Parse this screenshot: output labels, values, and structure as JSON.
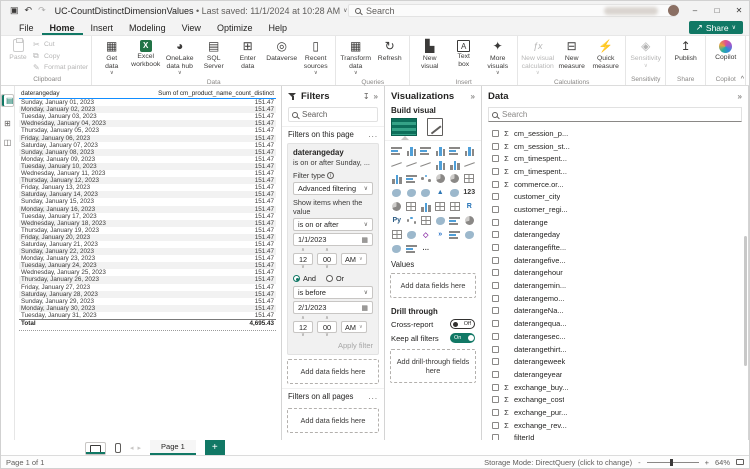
{
  "colors": {
    "accent_teal": "#117865",
    "header_underline_blue": "#118dff",
    "excel_green": "#217346",
    "toggle_on": "#117865"
  },
  "titlebar": {
    "title": "UC-CountDistinctDimensionValues",
    "saved": "• Last saved: 11/1/2024 at 10:28 AM",
    "search_placeholder": "Search"
  },
  "menu": {
    "items": [
      "File",
      "Home",
      "Insert",
      "Modeling",
      "View",
      "Optimize",
      "Help"
    ],
    "active": "Home",
    "share_label": "Share"
  },
  "ribbon": {
    "collapse_icon": "^",
    "groups": [
      {
        "name": "Clipboard",
        "layout": "clipboard",
        "paste": "Paste",
        "small": [
          {
            "label": "Cut",
            "glyph": "✂"
          },
          {
            "label": "Copy",
            "glyph": "⧉"
          },
          {
            "label": "Format painter",
            "glyph": "✎"
          }
        ]
      },
      {
        "name": "Data",
        "buttons": [
          {
            "label": "Get\ndata",
            "glyph": "▦",
            "caret": true
          },
          {
            "label": "Excel\nworkbook",
            "kind": "excel"
          },
          {
            "label": "OneLake\ndata hub",
            "glyph": "◕",
            "caret": true
          },
          {
            "label": "SQL\nServer",
            "glyph": "▤"
          },
          {
            "label": "Enter\ndata",
            "glyph": "⊞"
          },
          {
            "label": "Dataverse",
            "glyph": "◎"
          },
          {
            "label": "Recent\nsources",
            "glyph": "▯",
            "caret": true
          }
        ]
      },
      {
        "name": "Queries",
        "buttons": [
          {
            "label": "Transform\ndata",
            "glyph": "▦",
            "caret": true
          },
          {
            "label": "Refresh",
            "glyph": "↻"
          }
        ]
      },
      {
        "name": "Insert",
        "buttons": [
          {
            "label": "New\nvisual",
            "glyph": "▙"
          },
          {
            "label": "Text\nbox",
            "kind": "textbox"
          },
          {
            "label": "More\nvisuals",
            "glyph": "✦",
            "caret": true
          }
        ]
      },
      {
        "name": "Calculations",
        "buttons": [
          {
            "label": "New visual\ncalculation",
            "kind": "fx",
            "caret": true,
            "disabled": true
          },
          {
            "label": "New\nmeasure",
            "glyph": "⊟"
          },
          {
            "label": "Quick\nmeasure",
            "glyph": "⚡"
          }
        ]
      },
      {
        "name": "Sensitivity",
        "buttons": [
          {
            "label": "Sensitivity",
            "glyph": "◈",
            "caret": true,
            "disabled": true
          }
        ]
      },
      {
        "name": "Share",
        "buttons": [
          {
            "label": "Publish",
            "glyph": "↥"
          }
        ]
      },
      {
        "name": "Copilot",
        "buttons": [
          {
            "label": "Copilot",
            "kind": "copilot"
          }
        ]
      }
    ]
  },
  "rail": {
    "items": [
      {
        "name": "report-view",
        "glyph": "▤",
        "selected": true
      },
      {
        "name": "table-view",
        "glyph": "⊞",
        "selected": false
      },
      {
        "name": "model-view",
        "glyph": "◫",
        "selected": false
      }
    ]
  },
  "canvas": {
    "table": {
      "col1": "daterangeday",
      "col2": "Sum of cm_product_name_count_distinct",
      "rows": [
        [
          "Sunday, January 01, 2023",
          "151.47"
        ],
        [
          "Monday, January 02, 2023",
          "151.47"
        ],
        [
          "Tuesday, January 03, 2023",
          "151.47"
        ],
        [
          "Wednesday, January 04, 2023",
          "151.47"
        ],
        [
          "Thursday, January 05, 2023",
          "151.47"
        ],
        [
          "Friday, January 06, 2023",
          "151.47"
        ],
        [
          "Saturday, January 07, 2023",
          "151.47"
        ],
        [
          "Sunday, January 08, 2023",
          "151.47"
        ],
        [
          "Monday, January 09, 2023",
          "151.47"
        ],
        [
          "Tuesday, January 10, 2023",
          "151.47"
        ],
        [
          "Wednesday, January 11, 2023",
          "151.47"
        ],
        [
          "Thursday, January 12, 2023",
          "151.47"
        ],
        [
          "Friday, January 13, 2023",
          "151.47"
        ],
        [
          "Saturday, January 14, 2023",
          "151.47"
        ],
        [
          "Sunday, January 15, 2023",
          "151.47"
        ],
        [
          "Monday, January 16, 2023",
          "151.47"
        ],
        [
          "Tuesday, January 17, 2023",
          "151.47"
        ],
        [
          "Wednesday, January 18, 2023",
          "151.47"
        ],
        [
          "Thursday, January 19, 2023",
          "151.47"
        ],
        [
          "Friday, January 20, 2023",
          "151.47"
        ],
        [
          "Saturday, January 21, 2023",
          "151.47"
        ],
        [
          "Sunday, January 22, 2023",
          "151.47"
        ],
        [
          "Monday, January 23, 2023",
          "151.47"
        ],
        [
          "Tuesday, January 24, 2023",
          "151.47"
        ],
        [
          "Wednesday, January 25, 2023",
          "151.47"
        ],
        [
          "Thursday, January 26, 2023",
          "151.47"
        ],
        [
          "Friday, January 27, 2023",
          "151.47"
        ],
        [
          "Saturday, January 28, 2023",
          "151.47"
        ],
        [
          "Sunday, January 29, 2023",
          "151.47"
        ],
        [
          "Monday, January 30, 2023",
          "151.47"
        ],
        [
          "Tuesday, January 31, 2023",
          "151.47"
        ]
      ],
      "total_label": "Total",
      "total_value": "4,695.43"
    }
  },
  "filters": {
    "title": "Filters",
    "search_placeholder": "Search",
    "on_page_label": "Filters on this page",
    "more": "...",
    "card": {
      "field": "daterangeday",
      "condition": "is on or after Sunday, ...",
      "filter_type_label": "Filter type",
      "filter_type_value": "Advanced filtering",
      "show_items_label": "Show items when the value",
      "op1": "is on or after",
      "date1": "1/1/2023",
      "hour1": "12",
      "min1": "00",
      "ampm1": "AM",
      "and_label": "And",
      "or_label": "Or",
      "op2": "is before",
      "date2": "2/1/2023",
      "hour2": "12",
      "min2": "00",
      "ampm2": "AM",
      "apply_label": "Apply filter"
    },
    "add_fields": "Add data fields here",
    "all_pages_label": "Filters on all pages",
    "add_fields2": "Add data fields here"
  },
  "viz": {
    "title": "Visualizations",
    "build_label": "Build visual",
    "values_label": "Values",
    "add_fields": "Add data fields here",
    "drill_label": "Drill through",
    "cross_report_label": "Cross-report",
    "cross_report_state": "Off",
    "keep_filters_label": "Keep all filters",
    "keep_filters_state": "On",
    "add_drill": "Add drill-through fields here",
    "icons": [
      {
        "n": "stacked-bar-chart",
        "k": "hbar"
      },
      {
        "n": "stacked-column-chart",
        "k": "vbar"
      },
      {
        "n": "clustered-bar-chart",
        "k": "hbar"
      },
      {
        "n": "clustered-column-chart",
        "k": "vbar"
      },
      {
        "n": "100-stacked-bar-chart",
        "k": "hbar"
      },
      {
        "n": "100-stacked-column-chart",
        "k": "vbar"
      },
      {
        "n": "line-chart",
        "k": "line"
      },
      {
        "n": "area-chart",
        "k": "line"
      },
      {
        "n": "stacked-area-chart",
        "k": "line"
      },
      {
        "n": "line-and-stacked-column-chart",
        "k": "vbar"
      },
      {
        "n": "line-and-clustered-column-chart",
        "k": "vbar"
      },
      {
        "n": "ribbon-chart",
        "k": "line"
      },
      {
        "n": "waterfall-chart",
        "k": "vbar"
      },
      {
        "n": "funnel-chart",
        "k": "hbar"
      },
      {
        "n": "scatter-chart",
        "k": "dots"
      },
      {
        "n": "pie-chart",
        "k": "pie"
      },
      {
        "n": "donut-chart",
        "k": "pie"
      },
      {
        "n": "treemap",
        "k": "grid"
      },
      {
        "n": "map",
        "k": "map"
      },
      {
        "n": "filled-map",
        "k": "map"
      },
      {
        "n": "shape-map",
        "k": "map"
      },
      {
        "n": "azure-map",
        "k": "text",
        "t": "▲",
        "c": "#2e77b5"
      },
      {
        "n": "arcgis-map",
        "k": "map"
      },
      {
        "n": "card",
        "k": "text",
        "t": "123"
      },
      {
        "n": "gauge",
        "k": "pie"
      },
      {
        "n": "multi-row-card",
        "k": "grid"
      },
      {
        "n": "kpi",
        "k": "vbar"
      },
      {
        "n": "slicer",
        "k": "grid"
      },
      {
        "n": "table",
        "k": "grid"
      },
      {
        "n": "r-script-visual",
        "k": "text",
        "t": "R",
        "c": "#1f6fb5"
      },
      {
        "n": "python-visual",
        "k": "text",
        "t": "Py",
        "c": "#2b5b84"
      },
      {
        "n": "key-influencers",
        "k": "dots"
      },
      {
        "n": "decomposition-tree",
        "k": "grid"
      },
      {
        "n": "qa-visual",
        "k": "map"
      },
      {
        "n": "smart-narrative",
        "k": "hbar"
      },
      {
        "n": "metrics",
        "k": "pie"
      },
      {
        "n": "paginated-report",
        "k": "grid"
      },
      {
        "n": "arcgis-for-power-bi",
        "k": "map"
      },
      {
        "n": "power-apps-visual",
        "k": "text",
        "t": "◇",
        "c": "#8a2da5"
      },
      {
        "n": "power-automate-visual",
        "k": "text",
        "t": "»",
        "c": "#2471c7"
      },
      {
        "n": "custom-visual-1",
        "k": "hbar"
      },
      {
        "n": "custom-visual-2",
        "k": "map"
      },
      {
        "n": "custom-visual-3",
        "k": "map"
      },
      {
        "n": "custom-visual-4",
        "k": "hbar"
      },
      {
        "n": "get-more-visuals",
        "k": "text",
        "t": "…"
      }
    ]
  },
  "data_panel": {
    "title": "Data",
    "search_placeholder": "Search",
    "fields": [
      {
        "sigma": true,
        "name": "cm_session_p..."
      },
      {
        "sigma": true,
        "name": "cm_session_st..."
      },
      {
        "sigma": true,
        "name": "cm_timespent..."
      },
      {
        "sigma": true,
        "name": "cm_timespent..."
      },
      {
        "sigma": true,
        "name": "commerce.or..."
      },
      {
        "sigma": false,
        "name": "customer_city"
      },
      {
        "sigma": false,
        "name": "customer_regi..."
      },
      {
        "sigma": false,
        "name": "daterange"
      },
      {
        "sigma": false,
        "name": "daterangeday"
      },
      {
        "sigma": false,
        "name": "daterangefifte..."
      },
      {
        "sigma": false,
        "name": "daterangefive..."
      },
      {
        "sigma": false,
        "name": "daterangehour"
      },
      {
        "sigma": false,
        "name": "daterangemin..."
      },
      {
        "sigma": false,
        "name": "daterangemo..."
      },
      {
        "sigma": false,
        "name": "daterangeNa..."
      },
      {
        "sigma": false,
        "name": "daterangequa..."
      },
      {
        "sigma": false,
        "name": "daterangesec..."
      },
      {
        "sigma": false,
        "name": "daterangethirt..."
      },
      {
        "sigma": false,
        "name": "daterangeweek"
      },
      {
        "sigma": false,
        "name": "daterangeyear"
      },
      {
        "sigma": true,
        "name": "exchange_buy..."
      },
      {
        "sigma": true,
        "name": "exchange_cost"
      },
      {
        "sigma": true,
        "name": "exchange_pur..."
      },
      {
        "sigma": true,
        "name": "exchange_rev..."
      },
      {
        "sigma": false,
        "name": "filterId"
      }
    ]
  },
  "pagebar": {
    "page_label": "Page 1"
  },
  "statusbar": {
    "left": "Page 1 of 1",
    "storage": "Storage Mode: DirectQuery (click to change)",
    "zoom": "64%"
  }
}
